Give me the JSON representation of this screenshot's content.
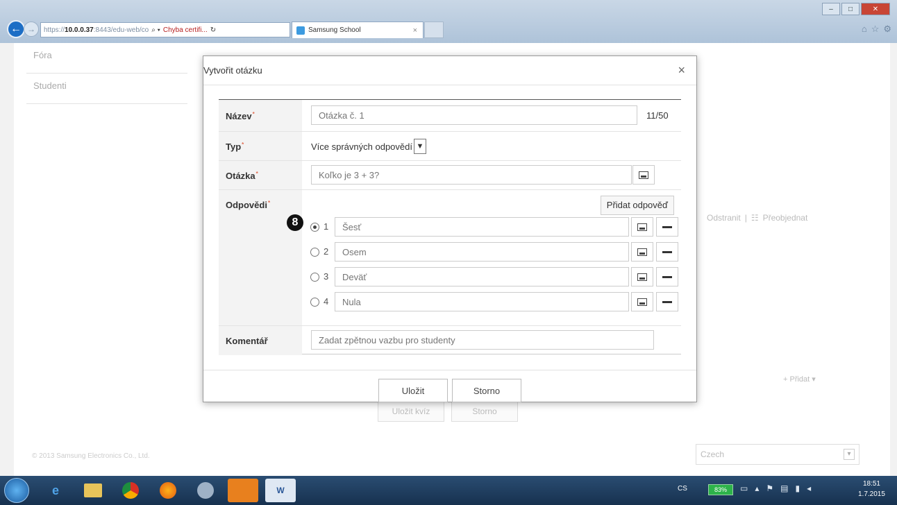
{
  "browser": {
    "address_prefix": "https://",
    "address_host": "10.0.0.37",
    "address_rest": ":8443/edu-web/co",
    "search_glyph": "⌕ ▾",
    "cert_error": "Chyba certifi...",
    "tab_title": "Samsung School",
    "tab_close": "×"
  },
  "sidebar": {
    "items": [
      {
        "label": "Fóra"
      },
      {
        "label": "Studenti"
      }
    ]
  },
  "background": {
    "actions": {
      "delete": "Odstranit",
      "separator": "|",
      "reorder": "Přeobjednat"
    },
    "add_label": "+ Přidat ▾",
    "copyright": "© 2013 Samsung Electronics Co., Ltd.",
    "language": "Czech",
    "save_quiz": "Uložit kvíz",
    "cancel": "Storno"
  },
  "dialog": {
    "title": "Vytvořit otázku",
    "close": "×",
    "fields": {
      "name": {
        "label": "Název",
        "placeholder": "Otázka č. 1",
        "counter": "11/50"
      },
      "type": {
        "label": "Typ",
        "value": "Více správných odpovědí"
      },
      "question": {
        "label": "Otázka",
        "placeholder": "Koľko je 3 + 3?"
      },
      "answers": {
        "label": "Odpovědi",
        "add_button": "Přidat odpověď",
        "items": [
          {
            "num": "1",
            "placeholder": "Šesť",
            "selected": true
          },
          {
            "num": "2",
            "placeholder": "Osem",
            "selected": false
          },
          {
            "num": "3",
            "placeholder": "Deväť",
            "selected": false
          },
          {
            "num": "4",
            "placeholder": "Nula",
            "selected": false
          }
        ]
      },
      "comment": {
        "label": "Komentář",
        "placeholder": "Zadat zpětnou vazbu pro studenty"
      }
    },
    "buttons": {
      "save": "Uložit",
      "cancel": "Storno"
    }
  },
  "annotation_badge": "8",
  "taskbar": {
    "language": "CS",
    "battery": "83%",
    "time": "18:51",
    "date": "1.7.2015"
  },
  "colors": {
    "required_marker": "#e06b4f",
    "battery": "#2db34a",
    "taskbar": "#1f3f63",
    "close_button": "#c84535"
  }
}
